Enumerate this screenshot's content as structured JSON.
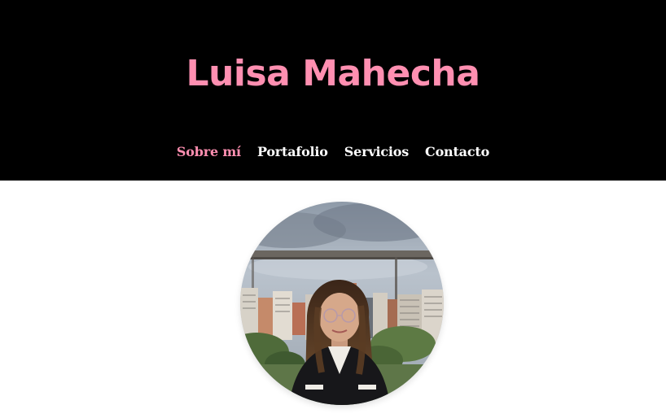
{
  "header": {
    "title": "Luisa Mahecha",
    "title_color": "#ff8fb1",
    "background": "#000000"
  },
  "nav": {
    "active_color": "#ff8fb1",
    "default_color": "#ffffff",
    "items": [
      {
        "label": "Sobre mí",
        "active": true
      },
      {
        "label": "Portafolio",
        "active": false
      },
      {
        "label": "Servicios",
        "active": false
      },
      {
        "label": "Contacto",
        "active": false
      }
    ]
  },
  "profile": {
    "image": "profile-photo"
  }
}
